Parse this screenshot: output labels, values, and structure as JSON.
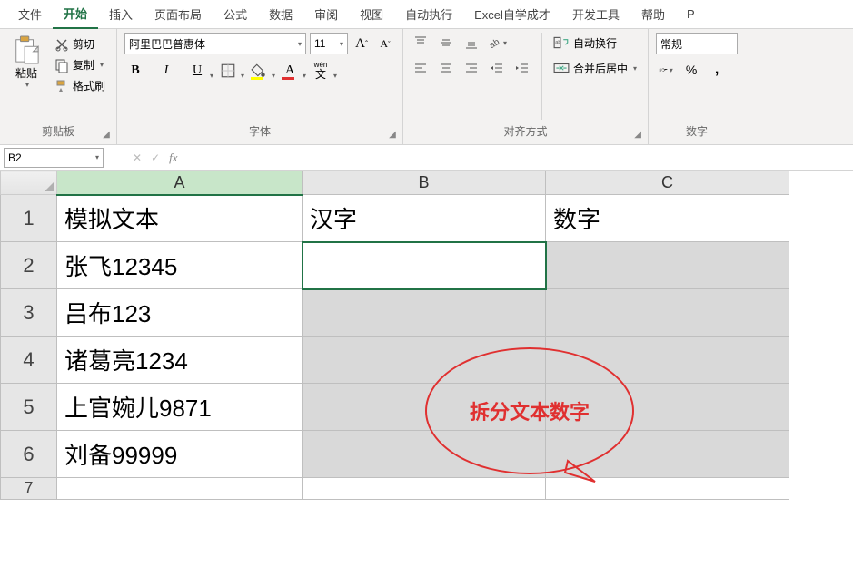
{
  "menu": {
    "items": [
      "文件",
      "开始",
      "插入",
      "页面布局",
      "公式",
      "数据",
      "审阅",
      "视图",
      "自动执行",
      "Excel自学成才",
      "开发工具",
      "帮助",
      "P"
    ],
    "active_index": 1
  },
  "ribbon": {
    "clipboard": {
      "label": "剪贴板",
      "paste": "粘贴",
      "cut": "剪切",
      "copy": "复制",
      "format_painter": "格式刷"
    },
    "font": {
      "label": "字体",
      "name": "阿里巴巴普惠体",
      "size": "11",
      "grow": "A",
      "shrink": "A",
      "bold": "B",
      "italic": "I",
      "underline": "U",
      "wen": "wén",
      "wen2": "文"
    },
    "align": {
      "label": "对齐方式",
      "wrap": "自动换行",
      "merge": "合并后居中"
    },
    "number": {
      "label": "数字",
      "format": "常规"
    }
  },
  "namebox": "B2",
  "sheet": {
    "columns": [
      "A",
      "B",
      "C"
    ],
    "rows": [
      "1",
      "2",
      "3",
      "4",
      "5",
      "6",
      "7"
    ],
    "cells": {
      "A1": "模拟文本",
      "B1": "汉字",
      "C1": "数字",
      "A2": "张飞12345",
      "A3": "吕布123",
      "A4": "诸葛亮1234",
      "A5": "上官婉儿9871",
      "A6": "刘备99999"
    }
  },
  "annotation": "拆分文本数字"
}
